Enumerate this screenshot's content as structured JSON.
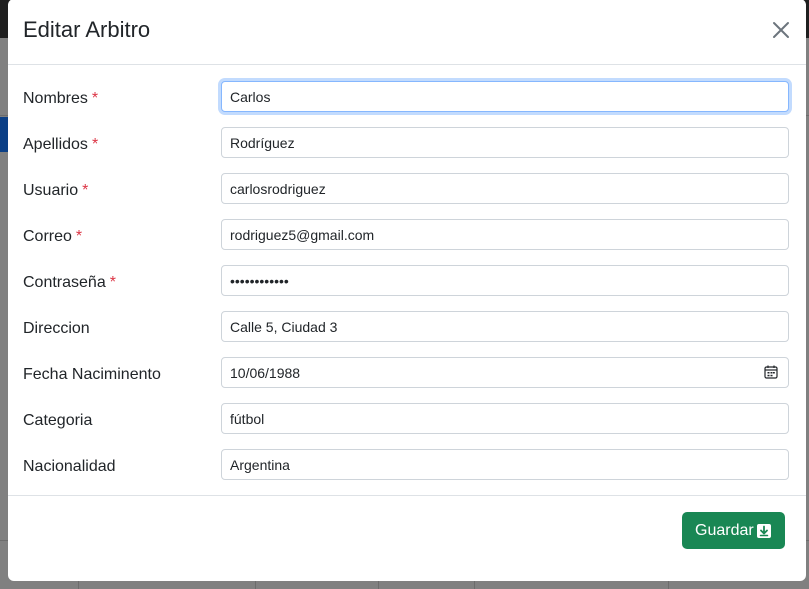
{
  "modal": {
    "title": "Editar Arbitro",
    "close_label": "×"
  },
  "fields": [
    {
      "label": "Nombres",
      "required": "*",
      "value": "Carlos"
    },
    {
      "label": "Apellidos",
      "required": "*",
      "value": "Rodríguez"
    },
    {
      "label": "Usuario",
      "required": "*",
      "value": "carlosrodriguez"
    },
    {
      "label": "Correo",
      "required": "*",
      "value": "rodriguez5@gmail.com"
    },
    {
      "label": "Contraseña",
      "required": "*",
      "value": "••••••••••••"
    },
    {
      "label": "Direccion",
      "required": "",
      "value": "Calle 5, Ciudad 3"
    },
    {
      "label": "Fecha Naciminento",
      "required": "",
      "value": "10/06/1988"
    },
    {
      "label": "Categoria",
      "required": "",
      "value": "fútbol"
    },
    {
      "label": "Nacionalidad",
      "required": "",
      "value": "Argentina"
    }
  ],
  "footer": {
    "save_label": "Guardar"
  },
  "colors": {
    "primary_button": "#198754",
    "required_asterisk": "#dc3545",
    "focus_border": "#86b7fe"
  },
  "icons": {
    "close": "close-icon",
    "calendar": "calendar-icon",
    "save": "download-box-icon"
  }
}
